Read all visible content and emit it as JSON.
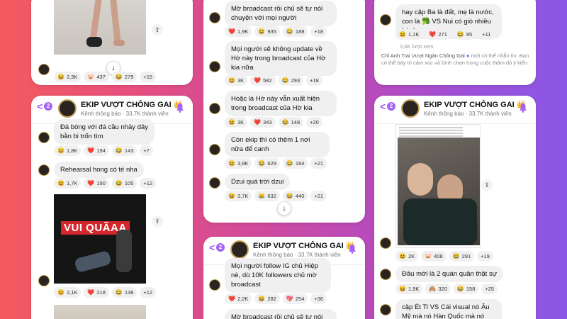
{
  "channel": {
    "name": "EKIP VƯỢT CHÔNG GAI",
    "crown": "👑",
    "subtitle": "Kênh thông báo · 33,7K thành viên",
    "unread": "2"
  },
  "col1": {
    "top_reactions": [
      [
        "😆",
        "2,3K"
      ],
      [
        "🐷",
        "437"
      ],
      [
        "😂",
        "279"
      ],
      [
        "",
        "+15"
      ]
    ],
    "messages": [
      {
        "text": "Đá bóng với đá cầu nhảy dây bằn bi trốn tìm",
        "reactions": [
          [
            "😆",
            "1,8K"
          ],
          [
            "❤️",
            "194"
          ],
          [
            "😂",
            "143"
          ],
          [
            "",
            "+7"
          ]
        ]
      },
      {
        "text": "Rehearsal hong có té nha",
        "reactions": [
          [
            "😆",
            "1,7K"
          ],
          [
            "❤️",
            "190"
          ],
          [
            "😂",
            "105"
          ],
          [
            "",
            "+12"
          ]
        ]
      }
    ],
    "image_caption": "VUI QUÃAA",
    "image_reactions": [
      [
        "😆",
        "2,1K"
      ],
      [
        "❤️",
        "218"
      ],
      [
        "😂",
        "138"
      ],
      [
        "",
        "+12"
      ]
    ]
  },
  "col2": {
    "messages": [
      {
        "text": "Mờ broadcast rồi chủ sẽ tự nói chuyện với mọi người",
        "reactions": [
          [
            "❤️",
            "1,9K"
          ],
          [
            "😆",
            "935"
          ],
          [
            "😂",
            "188"
          ],
          [
            "",
            "+18"
          ]
        ]
      },
      {
        "text": "Mọi người sẽ không update về Hờ này trong broadcast của Hờ kia nữa",
        "reactions": [
          [
            "😆",
            "3K"
          ],
          [
            "❤️",
            "582"
          ],
          [
            "😂",
            "293"
          ],
          [
            "",
            "+18"
          ]
        ]
      },
      {
        "text": "Hoặc là Hờ này vẫn xuất hiện trong broadcast của Hờ kia",
        "reactions": [
          [
            "😆",
            "3K"
          ],
          [
            "❤️",
            "343"
          ],
          [
            "😂",
            "148"
          ],
          [
            "",
            "+20"
          ]
        ]
      },
      {
        "text": "Còn ekip thì có thêm 1 nơi nữa để canh",
        "reactions": [
          [
            "😆",
            "3,9K"
          ],
          [
            "😂",
            "629"
          ],
          [
            "😂",
            "184"
          ],
          [
            "",
            "+21"
          ]
        ]
      },
      {
        "text": "Dzui quá trời dzui",
        "reactions": [
          [
            "😆",
            "3,7K"
          ],
          [
            "😹",
            "632"
          ],
          [
            "😂",
            "440"
          ],
          [
            "",
            "+21"
          ]
        ]
      }
    ],
    "bottom_messages": [
      {
        "text": "Mọi người follow IG chủ Hiệp nè, dù 10K followers chủ mờ broadcast",
        "reactions": [
          [
            "❤️",
            "2,2K"
          ],
          [
            "😆",
            "282"
          ],
          [
            "💖",
            "254"
          ],
          [
            "",
            "+36"
          ]
        ]
      },
      {
        "text": "Mờ broadcast rồi chủ sẽ tự nói",
        "reactions": []
      }
    ]
  },
  "col3": {
    "top_message": {
      "text": "hay cặp Ba là đất, mẹ là nước, con là 🥦 VS Nui có giò nhiều hành",
      "reactions": [
        [
          "😆",
          "1,1K"
        ],
        [
          "❤️",
          "271"
        ],
        [
          "😂",
          "85"
        ],
        [
          "",
          "+11"
        ]
      ]
    },
    "views": "3,6K lượt xem",
    "notice_name": "Chỉ Anh Trai Vượt Ngàn Chông Gai",
    "notice_text": "mới có thể nhắn tin. Bạn có thể bày tỏ cảm xúc và bình chọn trong cuộc thảm dò ý kiến.",
    "image_reactions": [
      [
        "😆",
        "2K"
      ],
      [
        "🐷",
        "408"
      ],
      [
        "😂",
        "291"
      ],
      [
        "",
        "+19"
      ]
    ],
    "messages": [
      {
        "text": "Đâu mới là 2 quán quân thật sự",
        "reactions": [
          [
            "😆",
            "1,9K"
          ],
          [
            "🙈",
            "320"
          ],
          [
            "😂",
            "158"
          ],
          [
            "",
            "+25"
          ]
        ]
      },
      {
        "text": "cặp Ét Ti VS Cái visual nó Âu Mỹ mà nó Hàn Quốc mà nó Nhật bản",
        "reactions": []
      }
    ]
  }
}
